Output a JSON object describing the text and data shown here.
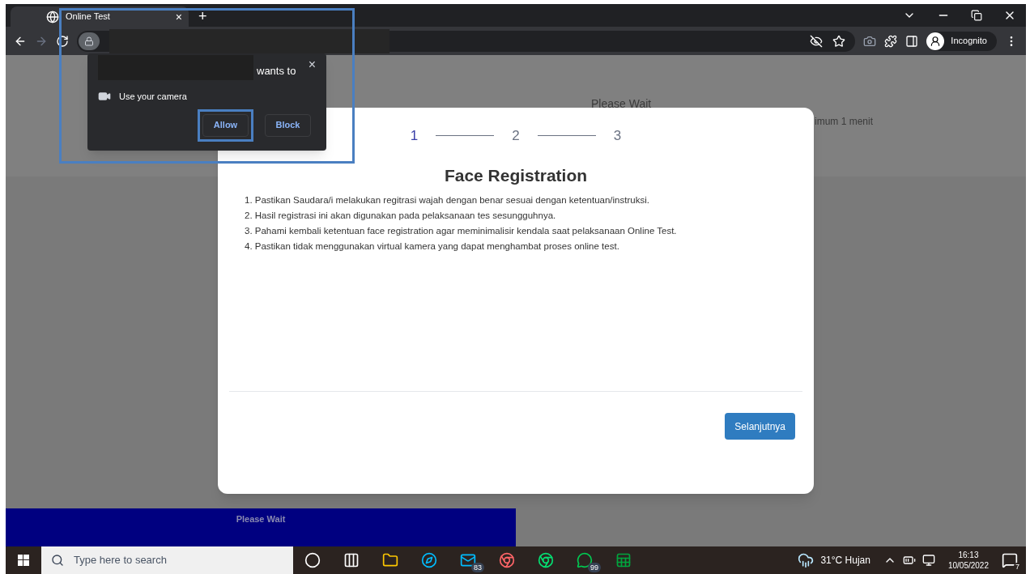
{
  "browser": {
    "tab": {
      "title": "Online Test",
      "close": "×"
    },
    "new_tab": "+",
    "profile": "Incognito"
  },
  "permission_popup": {
    "wants_to": "wants to",
    "close": "×",
    "permission": "Use your camera",
    "buttons": [
      {
        "label": "Allow",
        "highlighted": true
      },
      {
        "label": "Block",
        "highlighted": false
      }
    ]
  },
  "page": {
    "background_texts": [
      "Please Wait",
      "imum 1 menit"
    ],
    "bottom_bar": "Please Wait"
  },
  "dialog": {
    "steps": [
      {
        "label": "1",
        "selected": true
      },
      {
        "label": "2",
        "selected": false
      },
      {
        "label": "3",
        "selected": false
      }
    ],
    "title": "Face Registration",
    "instructions": [
      "1. Pastikan Saudara/i melakukan regitrasi wajah dengan benar sesuai dengan ketentuan/instruksi.",
      "2. Hasil registrasi ini akan digunakan pada pelaksanaan tes sesungguhnya.",
      "3. Pahami kembali ketentuan face registration agar meminimalisir kendala saat pelaksanaan Online Test.",
      "4. Pastikan tidak menggunakan virtual kamera yang dapat menghambat proses online test."
    ],
    "next_button": "Selanjutnya"
  },
  "taskbar": {
    "search_placeholder": "Type here to search",
    "apps": [
      {
        "kind": "cortana"
      },
      {
        "kind": "taskview"
      },
      {
        "kind": "folder"
      },
      {
        "kind": "edge"
      },
      {
        "kind": "mail",
        "badge": "83"
      },
      {
        "kind": "chrome"
      },
      {
        "kind": "chrome-profile"
      },
      {
        "kind": "whatsapp",
        "badge": "99"
      },
      {
        "kind": "excel"
      }
    ],
    "weather": "31°C Hujan",
    "time": "16:13",
    "date": "10/05/2022",
    "notifications": "7"
  }
}
